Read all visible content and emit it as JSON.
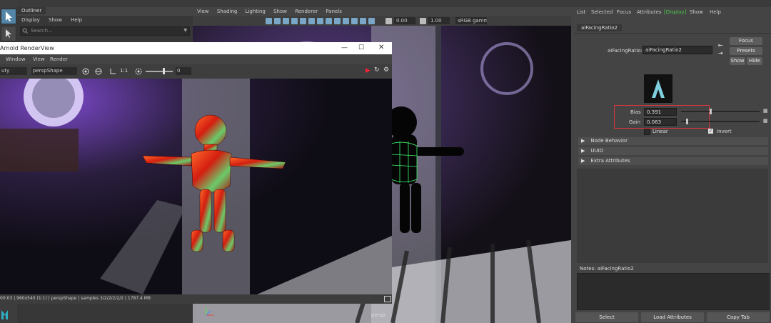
{
  "outliner": {
    "tab": "Outliner",
    "menu": [
      "Display",
      "Show",
      "Help"
    ],
    "search_placeholder": "Search..."
  },
  "viewport": {
    "menu": [
      "View",
      "Shading",
      "Lighting",
      "Show",
      "Renderer",
      "Panels"
    ],
    "exposure": "0.00",
    "gamma": "1.00",
    "colorspace": "sRGB gamma",
    "camera_label": "persp"
  },
  "renderview": {
    "title": "Arnold RenderView",
    "menu": [
      "Window",
      "View",
      "Render"
    ],
    "channel": "uty",
    "camera": "perspShape",
    "ratio": "1:1",
    "exposure": "0",
    "status": "00:03 | 960x540 (1:1) | perspShape | samples 3/2/2/2/2/2 | 1787.4 MB"
  },
  "attr": {
    "menu": [
      "List",
      "Selected",
      "Focus",
      "Attributes",
      "Display",
      "Show",
      "Help"
    ],
    "active_menu": "Display",
    "node_tab": "aiFacingRatio2",
    "name_label": "aiFacingRatio:",
    "name_value": "aiFacingRatio2",
    "focus": "Focus",
    "presets": "Presets",
    "show": "Show",
    "hide": "Hide",
    "bias_label": "Bias",
    "bias_value": "0.391",
    "bias_fraction": 0.391,
    "gain_label": "Gain",
    "gain_value": "0.063",
    "gain_fraction": 0.063,
    "linear": "Linear",
    "invert": "Invert",
    "invert_checked": true,
    "sections": [
      "Node Behavior",
      "UUID",
      "Extra Attributes"
    ],
    "notes": "Notes: aiFacingRatio2",
    "bottom_buttons": [
      "Select",
      "Load Attributes",
      "Copy Tab"
    ]
  },
  "colors": {
    "highlight_box": "#d9363e",
    "accent": "#5285a6",
    "display_menu": "#4ec94e"
  }
}
